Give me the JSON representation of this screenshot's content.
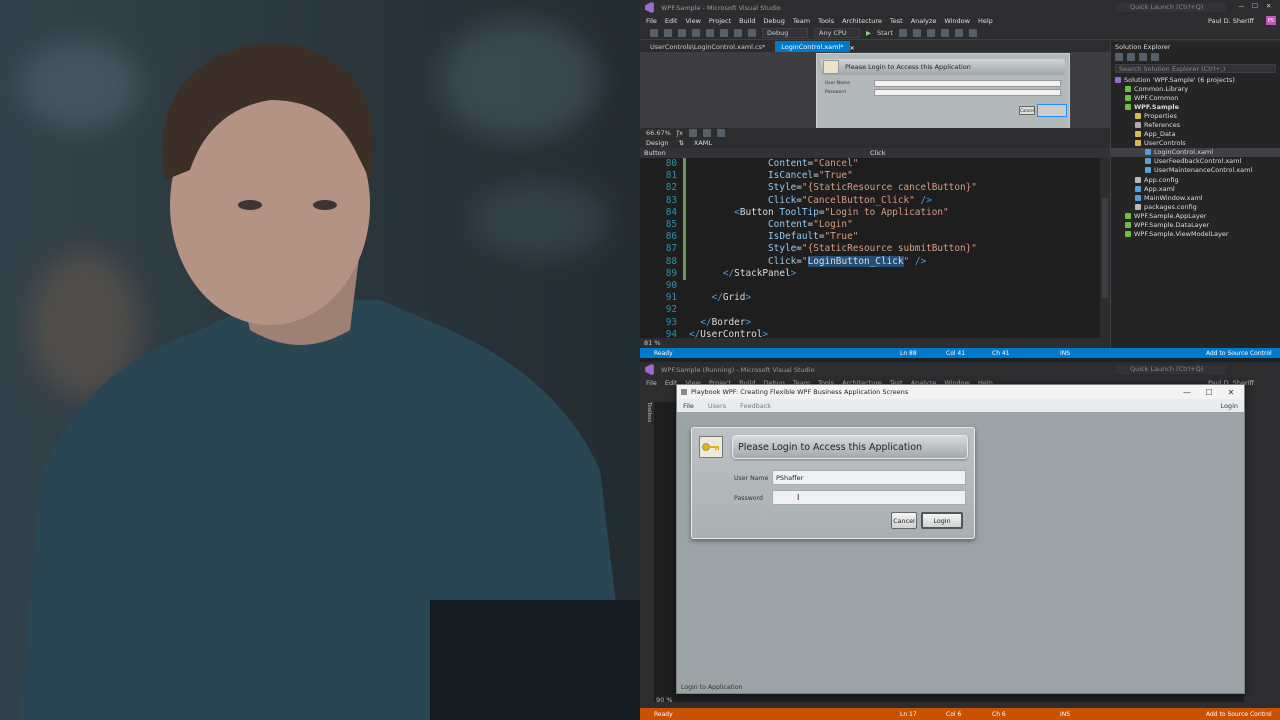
{
  "top_vs": {
    "window_title": "WPF.Sample - Microsoft Visual Studio",
    "quick_launch": "Quick Launch (Ctrl+Q)",
    "user": "Paul D. Sheriff",
    "user_initials": "PS",
    "menu": [
      "File",
      "Edit",
      "View",
      "Project",
      "Build",
      "Debug",
      "Team",
      "Tools",
      "Architecture",
      "Test",
      "Analyze",
      "Window",
      "Help"
    ],
    "config": "Debug",
    "platform": "Any CPU",
    "start": "Start",
    "tabs": [
      "UserControls\\LoginControl.xaml.cs*",
      "LoginControl.xaml*"
    ],
    "designer_title": "Please Login to Access this Application",
    "designer_user_label": "User Name",
    "designer_password_label": "Password",
    "designer_cancel": "Cancel",
    "designer_zoom": "66.67%",
    "design_tab": "Design",
    "xaml_tab": "XAML",
    "nav_left": "Button",
    "nav_right": "Click",
    "code_zoom": "81 %",
    "status": {
      "ready": "Ready",
      "ln": "Ln 88",
      "col": "Col 41",
      "ch": "Ch 41",
      "ins": "INS",
      "source_control": "Add to Source Control"
    },
    "solution_explorer": {
      "title": "Solution Explorer",
      "search": "Search Solution Explorer (Ctrl+;)",
      "items": [
        "Solution 'WPF.Sample' (6 projects)",
        "Common.Library",
        "WPF.Common",
        "WPF.Sample",
        "Properties",
        "References",
        "App_Data",
        "UserControls",
        "LoginControl.xaml",
        "UserFeedbackControl.xaml",
        "UserMaintenanceControl.xaml",
        "App.config",
        "App.xaml",
        "MainWindow.xaml",
        "packages.config",
        "WPF.Sample.AppLayer",
        "WPF.Sample.DataLayer",
        "WPF.Sample.ViewModelLayer"
      ]
    },
    "code_lines": [
      {
        "n": "80",
        "indent": "              ",
        "parts": [
          [
            "attr",
            "Content"
          ],
          [
            "el",
            "="
          ],
          [
            "str",
            "\"Cancel\""
          ]
        ]
      },
      {
        "n": "81",
        "indent": "              ",
        "parts": [
          [
            "attr",
            "IsCancel"
          ],
          [
            "el",
            "="
          ],
          [
            "str",
            "\"True\""
          ]
        ]
      },
      {
        "n": "82",
        "indent": "              ",
        "parts": [
          [
            "attr",
            "Style"
          ],
          [
            "el",
            "="
          ],
          [
            "str",
            "\"{StaticResource cancelButton}\""
          ]
        ]
      },
      {
        "n": "83",
        "indent": "              ",
        "parts": [
          [
            "attr",
            "Click"
          ],
          [
            "el",
            "="
          ],
          [
            "str",
            "\"CancelButton_Click\""
          ],
          [
            "tag",
            " />"
          ]
        ]
      },
      {
        "n": "84",
        "indent": "        ",
        "parts": [
          [
            "tag",
            "<"
          ],
          [
            "el",
            "Button "
          ],
          [
            "attr",
            "ToolTip"
          ],
          [
            "el",
            "="
          ],
          [
            "str",
            "\"Login to Application\""
          ]
        ]
      },
      {
        "n": "85",
        "indent": "              ",
        "parts": [
          [
            "attr",
            "Content"
          ],
          [
            "el",
            "="
          ],
          [
            "str",
            "\"Login\""
          ]
        ]
      },
      {
        "n": "86",
        "indent": "              ",
        "parts": [
          [
            "attr",
            "IsDefault"
          ],
          [
            "el",
            "="
          ],
          [
            "str",
            "\"True\""
          ]
        ]
      },
      {
        "n": "87",
        "indent": "              ",
        "parts": [
          [
            "attr",
            "Style"
          ],
          [
            "el",
            "="
          ],
          [
            "str",
            "\"{StaticResource submitButton}\""
          ]
        ]
      },
      {
        "n": "88",
        "indent": "              ",
        "parts": [
          [
            "attr",
            "Click"
          ],
          [
            "el",
            "="
          ],
          [
            "str",
            "\""
          ],
          [
            "hl",
            "LoginButton_Click"
          ],
          [
            "str",
            "\""
          ],
          [
            "tag",
            " />"
          ]
        ]
      },
      {
        "n": "89",
        "indent": "      ",
        "parts": [
          [
            "tag",
            "</"
          ],
          [
            "el",
            "StackPanel"
          ],
          [
            "tag",
            ">"
          ]
        ]
      },
      {
        "n": "90",
        "indent": "",
        "parts": []
      },
      {
        "n": "91",
        "indent": "    ",
        "parts": [
          [
            "tag",
            "</"
          ],
          [
            "el",
            "Grid"
          ],
          [
            "tag",
            ">"
          ]
        ]
      },
      {
        "n": "92",
        "indent": "",
        "parts": []
      },
      {
        "n": "93",
        "indent": "  ",
        "parts": [
          [
            "tag",
            "</"
          ],
          [
            "el",
            "Border"
          ],
          [
            "tag",
            ">"
          ]
        ]
      },
      {
        "n": "94",
        "indent": "",
        "parts": [
          [
            "tag",
            "</"
          ],
          [
            "el",
            "UserControl"
          ],
          [
            "tag",
            ">"
          ]
        ]
      }
    ]
  },
  "bottom_vs": {
    "window_title": "WPF.Sample (Running) - Microsoft Visual Studio",
    "quick_launch": "Quick Launch (Ctrl+Q)",
    "user": "Paul D. Sheriff",
    "toolbox": "Toolbox",
    "code_zoom": "90 %",
    "status": {
      "ready": "Ready",
      "ln": "Ln 17",
      "col": "Col 6",
      "ch": "Ch 6",
      "ins": "INS",
      "source_control": "Add to Source Control"
    }
  },
  "app": {
    "title": "Playbook WPF: Creating Flexible WPF Business Application Screens",
    "menu": [
      "File",
      "Users",
      "Feedback"
    ],
    "menu_right": "Login",
    "header": "Please Login to Access this Application",
    "user_label": "User Name",
    "user_value": "PShaffer",
    "password_label": "Password",
    "password_value": "",
    "cancel": "Cancel",
    "login": "Login",
    "status": "Login to Application"
  }
}
